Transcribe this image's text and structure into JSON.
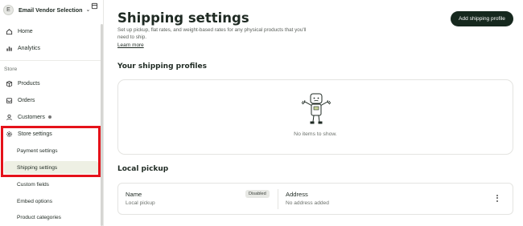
{
  "sidebar": {
    "vendor": {
      "avatar_letter": "E",
      "name": "Email Vendor Selection",
      "chevron": "chevron-down-icon",
      "store_icon": "store-icon"
    },
    "items": [
      {
        "label": "Home",
        "icon": "home-icon"
      },
      {
        "label": "Analytics",
        "icon": "bar-chart-icon"
      }
    ],
    "store_section_label": "Store",
    "store_items": [
      {
        "label": "Products",
        "icon": "box-icon"
      },
      {
        "label": "Orders",
        "icon": "inbox-icon"
      },
      {
        "label": "Customers",
        "icon": "person-icon",
        "has_dot": true
      },
      {
        "label": "Store settings",
        "icon": "gear-icon"
      }
    ],
    "sub_items": [
      {
        "label": "Payment settings",
        "active": false
      },
      {
        "label": "Shipping settings",
        "active": true
      },
      {
        "label": "Custom fields",
        "active": false
      },
      {
        "label": "Embed options",
        "active": false
      },
      {
        "label": "Product categories",
        "active": false
      }
    ],
    "highlight_color": "#e5121a"
  },
  "main": {
    "title": "Shipping settings",
    "description": "Set up pickup, flat rates, and weight-based rates for any physical products that you'll need to ship.",
    "learn_more": "Learn more",
    "add_button": "Add shipping profile",
    "profiles_heading": "Your shipping profiles",
    "empty_text": "No items to show.",
    "local_pickup_heading": "Local pickup",
    "pickup": {
      "name_label": "Name",
      "name_value": "Local pickup",
      "badge": "Disabled",
      "address_label": "Address",
      "address_value": "No address added",
      "menu_icon": "more-vertical-icon"
    }
  },
  "colors": {
    "primary_button": "#16281e",
    "active_nav": "#eef0e4",
    "highlight": "#e5121a"
  }
}
